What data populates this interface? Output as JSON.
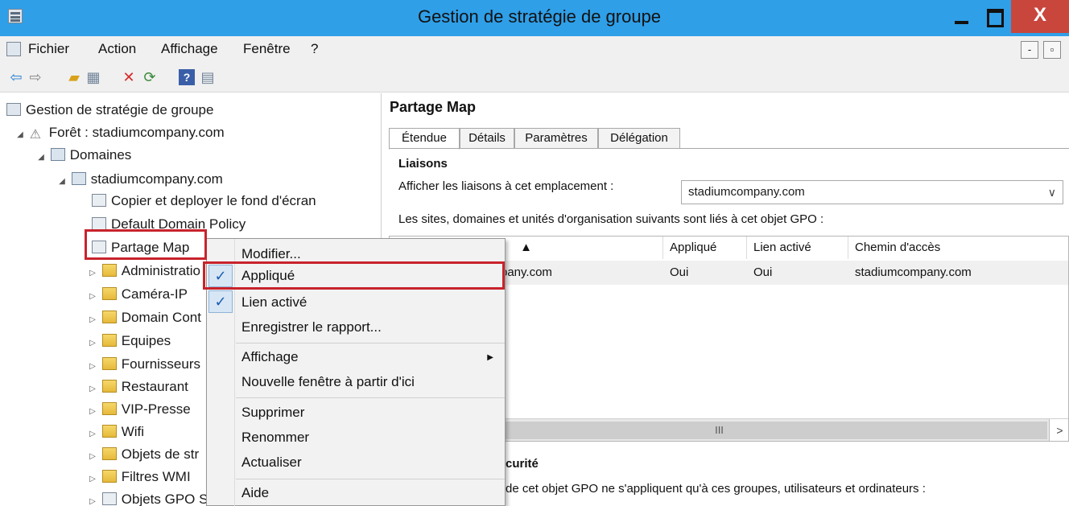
{
  "window": {
    "title": "Gestion de stratégie de groupe",
    "close_label": "X"
  },
  "menubar": {
    "items": [
      "Fichier",
      "Action",
      "Affichage",
      "Fenêtre",
      "?"
    ],
    "mdi_min": "-",
    "mdi_restore": "ð"
  },
  "toolbar": {
    "icons": [
      "back-icon",
      "forward-icon",
      "up-folder-icon",
      "show-hide-tree-icon",
      "delete-icon",
      "refresh-icon",
      "help-icon",
      "properties-icon"
    ]
  },
  "tree": {
    "root": "Gestion de stratégie de groupe",
    "forest": "Forêt : stadiumcompany.com",
    "domains": "Domaines",
    "domain": "stadiumcompany.com",
    "items": [
      "Copier et deployer le fond d'écran",
      "Default Domain Policy",
      "Partage Map",
      "Administratio",
      "Caméra-IP",
      "Domain Cont",
      "Equipes",
      "Fournisseurs",
      "Restaurant",
      "VIP-Presse",
      "Wifi",
      "Objets de str",
      "Filtres WMI",
      "Objets GPO S"
    ]
  },
  "right": {
    "title": "Partage Map",
    "tabs": [
      "Étendue",
      "Détails",
      "Paramètres",
      "Délégation"
    ],
    "liaisons_heading": "Liaisons",
    "show_links_label": "Afficher les liaisons à cet emplacement :",
    "location_value": "stadiumcompany.com",
    "linked_text": "Les sites, domaines et unités d'organisation suivants sont liés à cet objet GPO :",
    "columns": [
      "▲",
      "Appliqué",
      "Lien activé",
      "Chemin d'accès"
    ],
    "rows": [
      {
        "location": "pany.com",
        "applied": "Oui",
        "enabled": "Oui",
        "path": "stadiumcompany.com"
      }
    ],
    "scroll_grip": "III",
    "scroll_right": ">",
    "security_heading": "curité",
    "security_text": "de cet objet GPO ne s'appliquent qu'à ces groupes, utilisateurs et ordinateurs :"
  },
  "context_menu": {
    "items": [
      {
        "label": "Modifier...",
        "checked": false
      },
      {
        "label": "Appliqué",
        "checked": true
      },
      {
        "label": "Lien activé",
        "checked": true
      },
      {
        "label": "Enregistrer le rapport...",
        "checked": false
      },
      {
        "label": "Affichage",
        "checked": false,
        "submenu": true
      },
      {
        "label": "Nouvelle fenêtre à partir d'ici",
        "checked": false
      },
      {
        "label": "Supprimer",
        "checked": false
      },
      {
        "label": "Renommer",
        "checked": false
      },
      {
        "label": "Actualiser",
        "checked": false
      },
      {
        "label": "Aide",
        "checked": false
      }
    ],
    "check_glyph": "✓",
    "submenu_glyph": "▶"
  },
  "colors": {
    "titlebar": "#2f9fe8",
    "close": "#c9463d",
    "highlight": "#c8232c"
  }
}
